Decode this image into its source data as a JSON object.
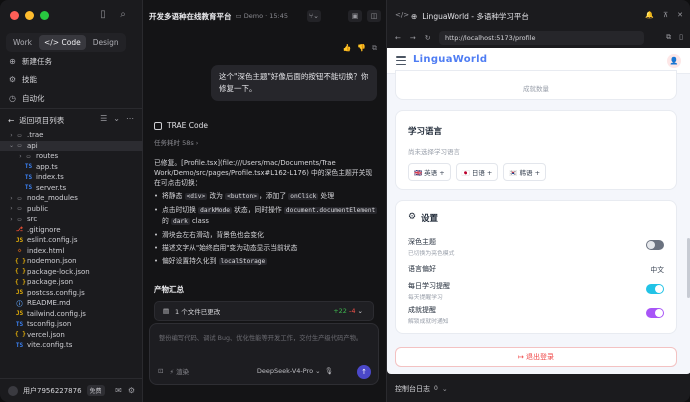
{
  "sidebar": {
    "tabs": [
      "Work",
      "Code",
      "Design"
    ],
    "nav": [
      {
        "icon": "plus-icon",
        "label": "新建任务"
      },
      {
        "icon": "skills-icon",
        "label": "技能"
      },
      {
        "icon": "automation-icon",
        "label": "自动化"
      }
    ],
    "back_label": "返回项目列表",
    "tree": [
      {
        "name": ".trae",
        "type": "folder",
        "depth": 0,
        "open": false
      },
      {
        "name": "api",
        "type": "folder",
        "depth": 0,
        "open": true,
        "selected": true
      },
      {
        "name": "routes",
        "type": "folder",
        "depth": 1,
        "open": false
      },
      {
        "name": "app.ts",
        "type": "ts",
        "depth": 1
      },
      {
        "name": "index.ts",
        "type": "ts",
        "depth": 1
      },
      {
        "name": "server.ts",
        "type": "ts",
        "depth": 1
      },
      {
        "name": "node_modules",
        "type": "folder",
        "depth": 0,
        "open": false
      },
      {
        "name": "public",
        "type": "folder",
        "depth": 0,
        "open": false
      },
      {
        "name": "src",
        "type": "folder",
        "depth": 0,
        "open": false
      },
      {
        "name": ".gitignore",
        "type": "git",
        "depth": 0
      },
      {
        "name": "eslint.config.js",
        "type": "js",
        "depth": 0
      },
      {
        "name": "index.html",
        "type": "html",
        "depth": 0
      },
      {
        "name": "nodemon.json",
        "type": "json",
        "depth": 0
      },
      {
        "name": "package-lock.json",
        "type": "json",
        "depth": 0
      },
      {
        "name": "package.json",
        "type": "json",
        "depth": 0
      },
      {
        "name": "postcss.config.js",
        "type": "js",
        "depth": 0
      },
      {
        "name": "README.md",
        "type": "md",
        "depth": 0
      },
      {
        "name": "tailwind.config.js",
        "type": "js",
        "depth": 0
      },
      {
        "name": "tsconfig.json",
        "type": "ts",
        "depth": 0
      },
      {
        "name": "vercel.json",
        "type": "json",
        "depth": 0
      },
      {
        "name": "vite.config.ts",
        "type": "ts",
        "depth": 0
      }
    ],
    "user": {
      "name": "用户7956227876",
      "badge": "免费"
    }
  },
  "chat": {
    "title": "开发多语种在线教育平台",
    "crumb": "Demo · 15:45",
    "user_message": "这个\"深色主题\"好像后面的按钮不能切换？你修复一下。",
    "ai_name": "TRAE Code",
    "task_time": "任务耗时 58s",
    "intro": "已修复。[Profile.tsx](file:///Users/mac/Documents/Trae Work/Demo/src/pages/Profile.tsx#L162-L176) 中的深色主题开关现在可点击切换：",
    "bullets": [
      {
        "pre": "将静态 ",
        "c1": "<div>",
        "mid": " 改为 ",
        "c2": "<button>",
        "mid2": "，添加了 ",
        "c3": "onClick",
        "post": " 处理"
      },
      {
        "pre": "点击时切换 ",
        "c1": "darkMode",
        "mid": " 状态，同时操作 ",
        "c2": "document.documentElement",
        "mid2": " 的 ",
        "c3": "dark",
        "post": " class"
      },
      {
        "text": "滑块会左右滑动，背景色也会变化"
      },
      {
        "text": "描述文字从\"始终启用\"变为动态显示当前状态"
      },
      {
        "pre": "偏好设置持久化到 ",
        "c1": "localStorage",
        "post": ""
      }
    ],
    "summary_title": "产物汇总",
    "files_changed": "1 个文件已更改",
    "additions": "+22",
    "deletions": "-4",
    "input_placeholder": "整份编写代码、调试 Bug、优化性能等开发工作，交付生产级代码产物。",
    "mode_label": "渲染",
    "model": "DeepSeek-V4-Pro"
  },
  "preview": {
    "tab_title": "LinguaWorld - 多语种学习平台",
    "url": "http://localhost:5173/profile",
    "logo": "LinguaWorld",
    "achievement_label": "成就数量",
    "lang_title": "学习语言",
    "lang_empty": "尚未选择学习语言",
    "languages": [
      "🇬🇧 英语 +",
      "🇯🇵 日语 +",
      "🇰🇷 韩语 +"
    ],
    "settings_title": "设置",
    "dark_title": "深色主题",
    "dark_sub": "已切换为亮色模式",
    "lang_pref": "语言偏好",
    "lang_pref_value": "中文",
    "daily_title": "每日学习提醒",
    "daily_sub": "每天提醒学习",
    "ach_title": "成就提醒",
    "ach_sub": "解锁成就时通知",
    "logout": "退出登录",
    "console": "控制台日志",
    "console_count": "0"
  },
  "colors": {
    "accent": "#4f7df3",
    "toggle_cyan": "#22c3e6",
    "toggle_purple": "#a855f7",
    "danger": "#ef4444"
  }
}
